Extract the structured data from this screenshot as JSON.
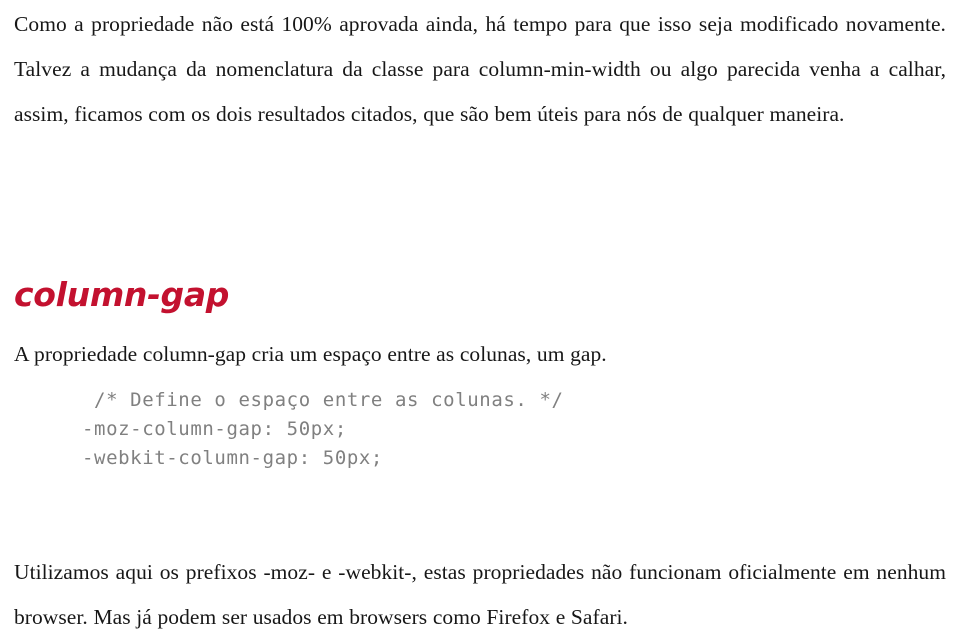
{
  "document": {
    "background_color": "#ffffff",
    "body_text_color": "#171717",
    "accent_color": "#c3112f",
    "code_text_color": "#808080"
  },
  "intro_paragraph": {
    "text": "Como a propriedade não está 100% aprovada ainda, há tempo para que isso seja modificado novamente. Talvez a mudança da nomenclatura da classe para column-min-width ou algo parecida venha a calhar, assim, ficamos com os dois resultados citados, que são bem úteis para nós de qualquer maneira."
  },
  "heading": {
    "text": "column-gap"
  },
  "description_paragraph": {
    "text": "A propriedade column-gap cria um espaço entre as colunas, um gap."
  },
  "code_block": {
    "lines": [
      " /* Define o espaço entre as colunas. */",
      "-moz-column-gap: 50px;",
      "-webkit-column-gap: 50px;"
    ],
    "line_1": " /* Define o espaço entre as colunas. */",
    "line_2": "-moz-column-gap: 50px;",
    "line_3": "-webkit-column-gap: 50px;"
  },
  "closing_paragraph": {
    "text": "Utilizamos aqui os prefixos -moz- e -webkit-, estas propriedades não funcionam oficialmente em nenhum browser. Mas já podem ser usados em browsers como Firefox e Safari."
  }
}
